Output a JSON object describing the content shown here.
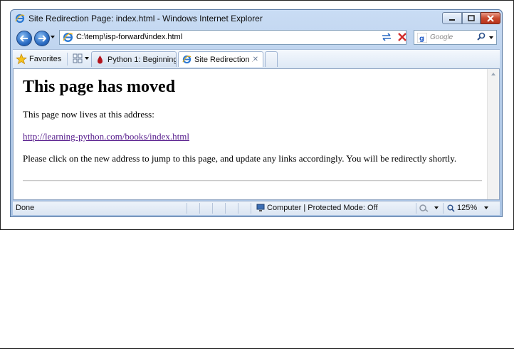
{
  "window": {
    "title": "Site Redirection Page: index.html - Windows Internet Explorer"
  },
  "navbar": {
    "address": "C:\\temp\\isp-forward\\index.html",
    "search_placeholder": "Google"
  },
  "favorites_bar": {
    "favorites_label": "Favorites"
  },
  "tabs": [
    {
      "label": "Python 1: Beginning...",
      "icon": "python-tab-icon",
      "active": false
    },
    {
      "label": "Site Redirection ...",
      "icon": "ie-page-icon",
      "active": true
    }
  ],
  "page": {
    "heading": "This page has moved",
    "intro": "This page now lives at this address:",
    "link": "http://learning-python.com/books/index.html",
    "instructions": "Please click on the new address to jump to this page, and update any links accordingly. You will be redirectly shortly."
  },
  "status": {
    "text": "Done",
    "zone": "Computer | Protected Mode: Off",
    "zoom": "125%"
  },
  "colors": {
    "link_visited": "#551a8b",
    "chrome_blue": "#b6cde9",
    "close_red": "#c94a2f"
  }
}
